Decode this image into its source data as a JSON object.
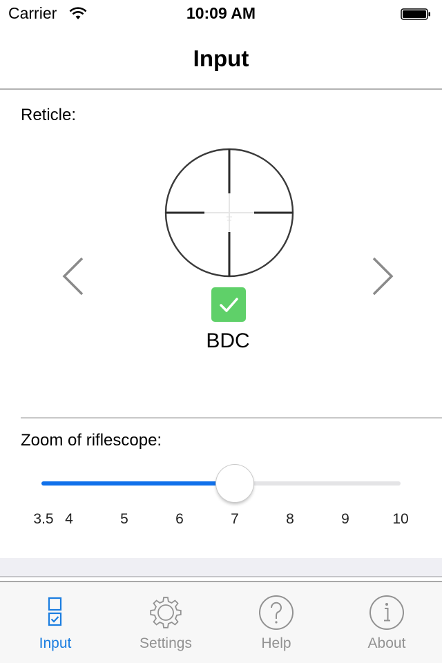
{
  "status_bar": {
    "carrier": "Carrier",
    "time": "10:09 AM",
    "wifi_icon": "wifi-icon",
    "battery_icon": "battery-icon"
  },
  "nav": {
    "title": "Input"
  },
  "reticle": {
    "label": "Reticle:",
    "name": "BDC",
    "selected": true,
    "prev_icon": "chevron-left-icon",
    "next_icon": "chevron-right-icon",
    "check_color": "#5fd069"
  },
  "zoom": {
    "label": "Zoom of riflescope:",
    "min": 3.5,
    "max": 10,
    "value": 7,
    "fill_color": "#1070ea",
    "ticks": [
      "3.5",
      "4",
      "5",
      "6",
      "7",
      "8",
      "9",
      "10"
    ],
    "tick_values": [
      3.5,
      4,
      5,
      6,
      7,
      8,
      9,
      10
    ]
  },
  "tabbar": {
    "active_color": "#1a7de0",
    "inactive_color": "#929292",
    "tabs": [
      {
        "label": "Input",
        "icon": "checklist-icon",
        "active": true
      },
      {
        "label": "Settings",
        "icon": "gear-icon",
        "active": false
      },
      {
        "label": "Help",
        "icon": "question-icon",
        "active": false
      },
      {
        "label": "About",
        "icon": "info-icon",
        "active": false
      }
    ]
  }
}
